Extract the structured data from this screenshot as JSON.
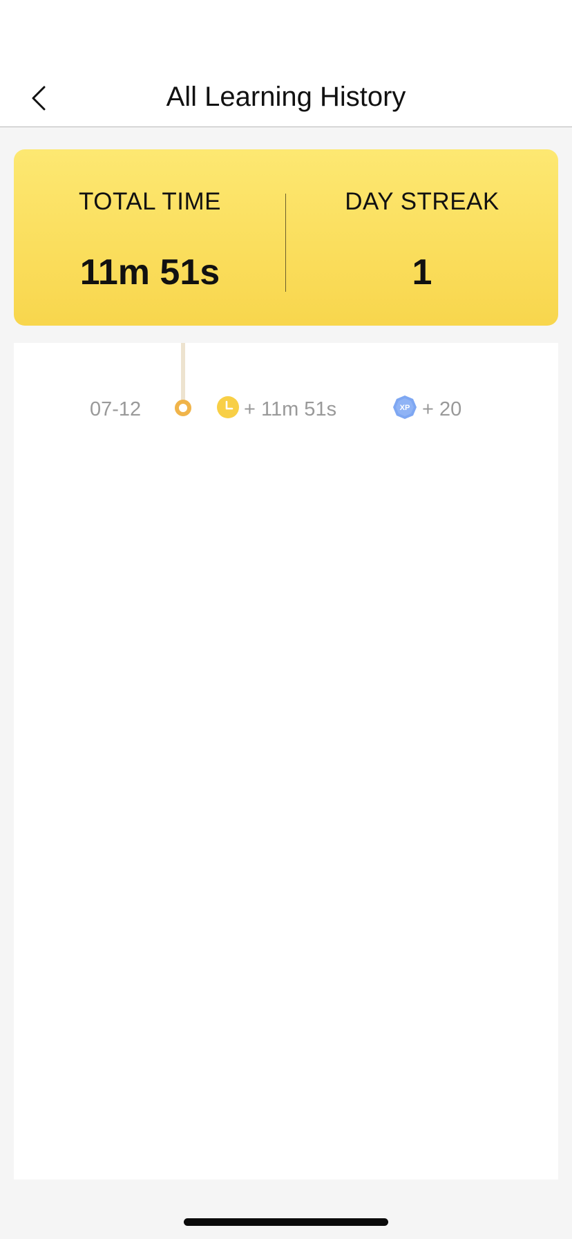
{
  "header": {
    "title": "All Learning History",
    "back_icon": "chevron-left-icon"
  },
  "summary": {
    "total_time_label": "TOTAL TIME",
    "total_time_value": "11m 51s",
    "day_streak_label": "DAY STREAK",
    "day_streak_value": "1"
  },
  "history": {
    "items": [
      {
        "date": "07-12",
        "time_gain": "+ 11m 51s",
        "time_icon": "clock-icon",
        "xp_badge": "XP",
        "xp_icon": "xp-badge-icon",
        "xp_gain": "+ 20"
      }
    ]
  },
  "colors": {
    "card_gradient_top": "#fde872",
    "card_gradient_bottom": "#f8d64d",
    "timeline_dot": "#f0b44a",
    "timeline_line": "#ede3cf",
    "clock": "#f8cf46",
    "xp_badge": "#7ea7f2",
    "muted_text": "#999999"
  }
}
